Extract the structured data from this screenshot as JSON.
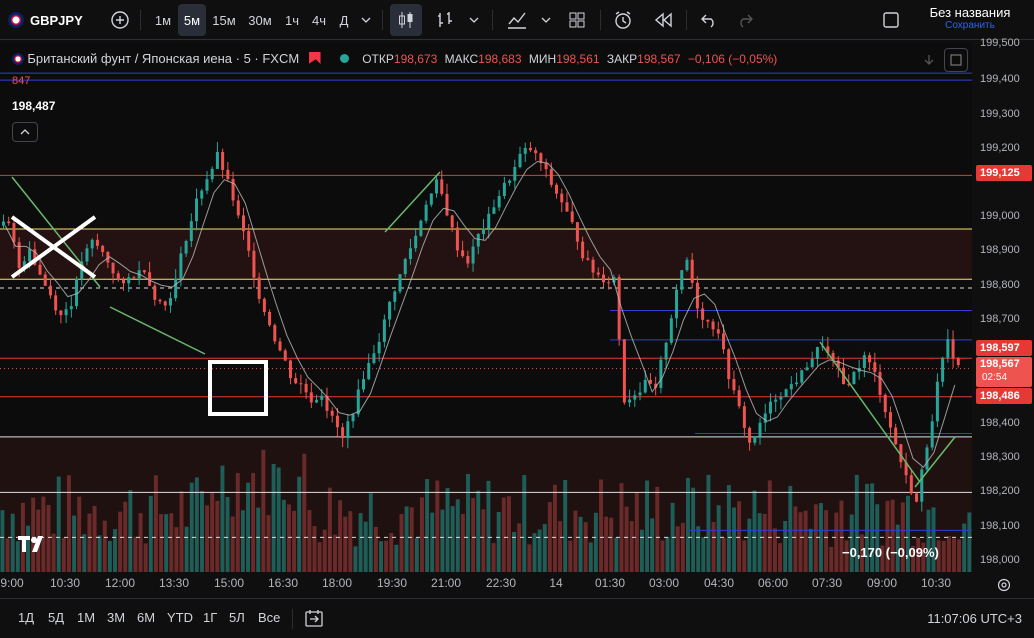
{
  "toolbar": {
    "symbol": "GBPJPY",
    "intervals": [
      "1м",
      "5м",
      "15м",
      "30м",
      "1ч",
      "4ч",
      "Д"
    ],
    "active_interval": "5м",
    "layout_name": "Без названия",
    "save_label": "Сохранить"
  },
  "legend": {
    "title": "Британский фунт / Японская иена · 5 · FXCM",
    "open_label": "ОТКР",
    "open": "198,673",
    "high_label": "МАКС",
    "high": "198,683",
    "low_label": "МИН",
    "low": "198,561",
    "close_label": "ЗАКР",
    "close": "198,567",
    "change": "−0,106 (−0,05%)",
    "indicator_value": "847",
    "crosshair_price": "198,487"
  },
  "y_axis": {
    "ticks": [
      "199,500",
      "199,400",
      "199,300",
      "199,200",
      "199,000",
      "198,900",
      "198,800",
      "198,700",
      "198,400",
      "198,300",
      "198,200",
      "198,100",
      "198,000"
    ],
    "tag_upper": "199,125",
    "tag_alert": "198,597",
    "tag_price": "198,567",
    "tag_timer": "02:54",
    "tag_lower": "198,486"
  },
  "x_axis": {
    "ticks": [
      "9:00",
      "10:30",
      "12:00",
      "13:30",
      "15:00",
      "16:30",
      "18:00",
      "19:30",
      "21:00",
      "22:30",
      "14",
      "01:30",
      "03:00",
      "04:30",
      "06:00",
      "07:30",
      "09:00",
      "10:30"
    ]
  },
  "chart_overlay": {
    "measure_label": "−0,170 (−0,09%)"
  },
  "bottom": {
    "ranges": [
      "1Д",
      "5Д",
      "1М",
      "3М",
      "6М",
      "YTD",
      "1Г",
      "5Л",
      "Все"
    ],
    "time": "11:07:06 UTC+3"
  },
  "colors": {
    "up": "#26a69a",
    "down": "#ef5350",
    "red_line": "#e53935",
    "yellow_line": "#f5e66a",
    "blue_line": "#2f3fd6",
    "white_line": "#e0e0e0",
    "green_line": "#66bb6a"
  },
  "chart_data": {
    "type": "candlestick",
    "symbol": "GBPJPY",
    "interval": "5",
    "y_range": [
      197.98,
      199.51
    ],
    "close_series": [
      198.98,
      198.86,
      198.92,
      198.84,
      198.78,
      198.72,
      198.76,
      198.88,
      198.93,
      198.9,
      198.85,
      198.8,
      198.84,
      198.86,
      198.78,
      198.75,
      198.82,
      198.95,
      199.05,
      199.12,
      199.18,
      199.1,
      199.0,
      198.9,
      198.78,
      198.7,
      198.62,
      198.55,
      198.52,
      198.48,
      198.5,
      198.42,
      198.36,
      198.45,
      198.55,
      198.62,
      198.7,
      198.8,
      198.88,
      198.95,
      199.05,
      199.1,
      199.02,
      198.92,
      198.88,
      198.95,
      199.0,
      199.07,
      199.12,
      199.18,
      199.2,
      199.16,
      199.1,
      199.05,
      198.98,
      198.9,
      198.85,
      198.83,
      198.83,
      198.48,
      198.5,
      198.52,
      198.5,
      198.65,
      198.8,
      198.88,
      198.75,
      198.7,
      198.68,
      198.55,
      198.45,
      198.35,
      198.4,
      198.46,
      198.5,
      198.52,
      198.55,
      198.6,
      198.64,
      198.58,
      198.52,
      198.55,
      198.6,
      198.55,
      198.45,
      198.35,
      198.25,
      198.18,
      198.35,
      198.52,
      198.64,
      198.57
    ],
    "horizontal_levels": {
      "red": [
        199.125,
        198.597,
        198.486
      ],
      "yellow": [
        198.97,
        198.825
      ],
      "blue": [
        199.42,
        199.4,
        198.735,
        198.65,
        198.38,
        198.1
      ],
      "white": [
        198.37,
        198.21
      ]
    },
    "volume": "shown"
  }
}
